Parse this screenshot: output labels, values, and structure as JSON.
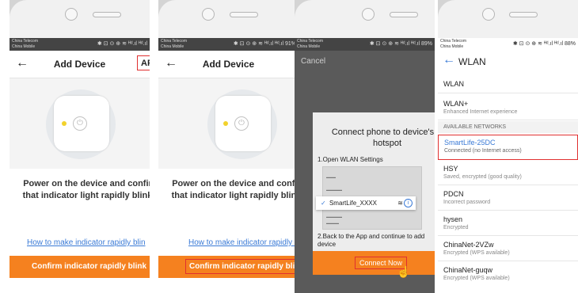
{
  "status": {
    "carrier1": "China Telecom",
    "carrier2": "China Mobile",
    "right_p1": "✱ ⊡ ⊙ ⊕ ≋ ᴴᵈ.ıl ᴴᵈ.ıl",
    "right_p2": "✱ ⊡ ⊙ ⊕ ≋ ᴴᵈ.ıl ᴴᵈ.ıl 91%",
    "right_p3": "✱ ⊡ ⊙ ⊕ ≋ ᴴᵈ.ıl ᴴᵈ.ıl 89%",
    "right_p4": "✱ ⊡ ⊙ ⊕ ≋ ᴴᵈ.ıl ᴴᵈ.ıl 88%"
  },
  "add_device": {
    "title": "Add Device",
    "ap_label": "AP",
    "instruction_line1": "Power on the device and confir",
    "instruction_line2": "that indicator light rapidly blink",
    "help_link": "How to make indicator rapidly blin",
    "help_link_2": "How to make indicator rapidly blin",
    "confirm_label": "Confirm indicator rapidly blink",
    "confirm_label_2": "Confirm indicator rapidly blink"
  },
  "hotspot": {
    "cancel": "Cancel",
    "title_line1": "Connect phone to device's w",
    "title_line2": "hotspot",
    "step1": "1.Open WLAN Settings",
    "popup_check": "✓",
    "popup_network": "SmartLife_XXXX",
    "step2": "2.Back to the App and continue to add device",
    "connect_label": "Connect Now"
  },
  "wlan": {
    "title": "WLAN",
    "row_wlan": "WLAN",
    "row_wlanplus": "WLAN+",
    "row_wlanplus_sub": "Enhanced Internet experience",
    "section": "AVAILABLE NETWORKS",
    "networks": [
      {
        "name": "SmartLife-25DC",
        "status": "Connected (no Internet access)"
      },
      {
        "name": "HSY",
        "status": "Saved, encrypted (good quality)"
      },
      {
        "name": "PDCN",
        "status": "Incorrect password"
      },
      {
        "name": "hysen",
        "status": "Encrypted"
      },
      {
        "name": "ChinaNet-2VZw",
        "status": "Encrypted (WPS available)"
      },
      {
        "name": "ChinaNet-guqw",
        "status": "Encrypted (WPS available)"
      }
    ]
  },
  "colors": {
    "accent": "#f5811f",
    "link": "#3a7ad6",
    "highlight": "#e03030"
  }
}
